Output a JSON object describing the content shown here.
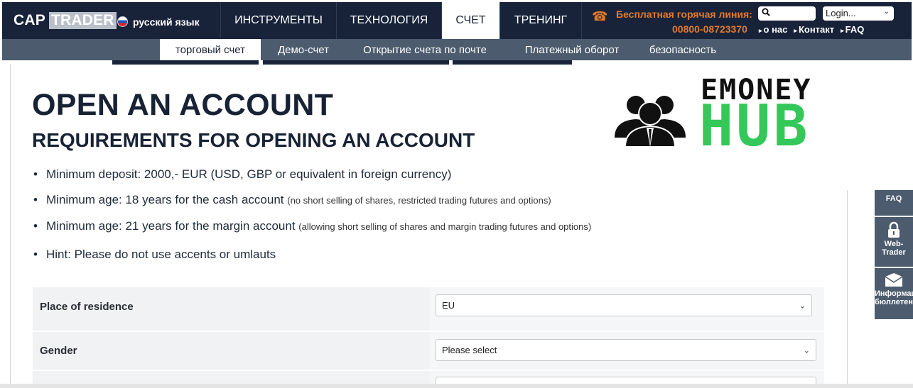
{
  "header": {
    "logo_cap": "CAP",
    "logo_trader": "TRADER",
    "language": "русский язык",
    "nav": [
      {
        "label": "ИНСТРУМЕНТЫ"
      },
      {
        "label": "ТЕХНОЛОГИЯ"
      },
      {
        "label": "СЧЕТ",
        "active": true
      },
      {
        "label": "ТРЕНИНГ"
      }
    ],
    "hotline_label": "Бесплатная горячая линия:",
    "hotline_phone": "00800-08723370",
    "login_placeholder": "Login...",
    "links": [
      "о нас",
      "Контакт",
      "FAQ"
    ]
  },
  "subnav": [
    {
      "label": "торговый счет",
      "active": true
    },
    {
      "label": "Демо-счет"
    },
    {
      "label": "Открытие счета по почте"
    },
    {
      "label": "Платежный оборот"
    },
    {
      "label": "безопасность"
    }
  ],
  "page": {
    "title": "OPEN AN ACCOUNT",
    "subtitle": "REQUIREMENTS FOR OPENING AN ACCOUNT",
    "requirements": [
      {
        "text": "Minimum deposit: 2000,- EUR (USD, GBP or equivalent in foreign currency)",
        "note": ""
      },
      {
        "text": "Minimum age: 18 years for the cash account",
        "note": "(no short selling of shares, restricted trading futures and options)"
      },
      {
        "text": "Minimum age: 21 years for the margin account",
        "note": "(allowing short selling of shares and margin trading futures and options)"
      },
      {
        "text": "Hint: Please do not use accents or umlauts",
        "note": ""
      }
    ]
  },
  "form": {
    "residence_label": "Place of residence",
    "residence_value": "EU",
    "gender_label": "Gender",
    "gender_value": "Please select"
  },
  "watermark": {
    "line1": "EMONEY",
    "line2": "HUB"
  },
  "side_tabs": [
    {
      "label": "FAQ"
    },
    {
      "label": "Web-Trader"
    },
    {
      "label": "Информация бюллетень"
    }
  ],
  "colors": {
    "navbar": "#18233a",
    "subnav": "#4c5b6e",
    "accent_orange": "#e07a2c",
    "hub_green": "#34c759"
  }
}
